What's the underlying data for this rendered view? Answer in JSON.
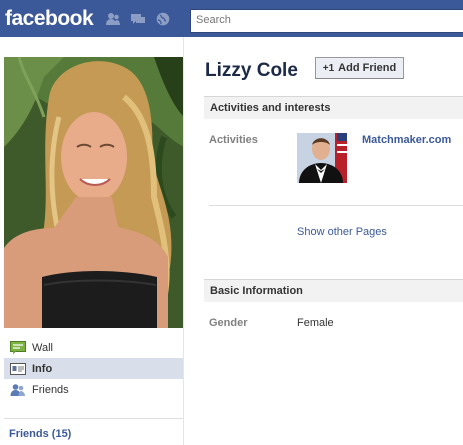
{
  "header": {
    "logo": "facebook",
    "search_placeholder": "Search",
    "jewels": [
      "friend-requests-icon",
      "messages-icon",
      "notifications-icon"
    ]
  },
  "profile": {
    "name": "Lizzy Cole",
    "add_friend_label": "Add Friend"
  },
  "nav": {
    "items": [
      {
        "label": "Wall",
        "icon": "wall-icon"
      },
      {
        "label": "Info",
        "icon": "info-icon",
        "active": true
      },
      {
        "label": "Friends",
        "icon": "friends-icon"
      }
    ],
    "friends_count_label": "Friends (15)"
  },
  "sections": {
    "activities": {
      "title": "Activities and interests",
      "activities_label": "Activities",
      "activities_page": "Matchmaker.com",
      "show_other_pages": "Show other Pages"
    },
    "basic": {
      "title": "Basic Information",
      "gender_label": "Gender",
      "gender_value": "Female"
    }
  },
  "colors": {
    "brand": "#3b5998",
    "active_nav_bg": "#d8dfea",
    "section_bg": "#f2f2f2"
  }
}
